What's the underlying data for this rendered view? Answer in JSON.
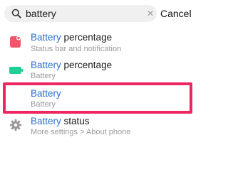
{
  "search": {
    "value": "battery",
    "cancel_label": "Cancel"
  },
  "results": [
    {
      "highlight": "Battery",
      "rest": " percentage",
      "subtitle": "Status bar and notification",
      "icon": "notification-icon",
      "icon_color": "#f2546b"
    },
    {
      "highlight": "Battery",
      "rest": " percentage",
      "subtitle": "Battery",
      "icon": "battery-icon",
      "icon_color": "#1fcf98"
    },
    {
      "highlight": "Battery",
      "rest": "",
      "subtitle": "Battery",
      "icon": "",
      "selected": true
    },
    {
      "highlight": "Battery",
      "rest": " status",
      "subtitle": "More settings > About phone",
      "icon": "gear-icon",
      "icon_color": "#9a9a9a"
    }
  ],
  "colors": {
    "highlight_text": "#2f6fd0",
    "selection_border": "#ee2560"
  }
}
